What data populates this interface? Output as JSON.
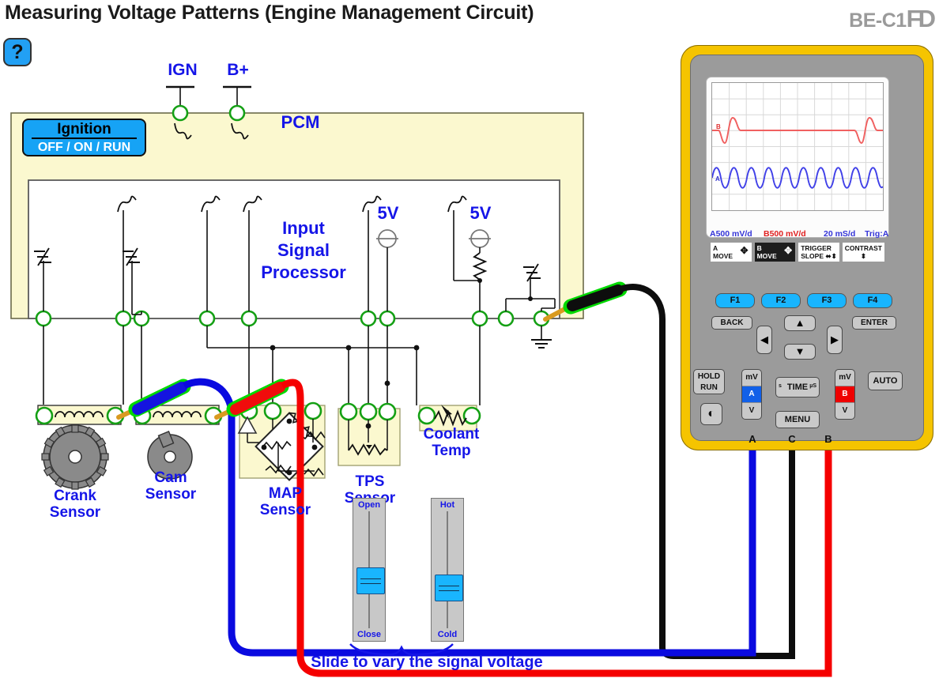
{
  "header": {
    "title": "Measuring Voltage Patterns (Engine Management Circuit)",
    "logo": "BE-C1",
    "logo_suffix": "FD",
    "help_label": "?"
  },
  "diagram": {
    "pcm_label": "PCM",
    "processor_label_line1": "Input",
    "processor_label_line2": "Signal",
    "processor_label_line3": "Processor",
    "ignition": {
      "title": "Ignition",
      "states": "OFF / ON / RUN"
    },
    "supply_labels": {
      "ign": "IGN",
      "bplus": "B+"
    },
    "rail_5v_left": "5V",
    "rail_5v_right": "5V",
    "sensors": [
      {
        "name": "crank",
        "line1": "Crank",
        "line2": "Sensor"
      },
      {
        "name": "cam",
        "line1": "Cam",
        "line2": "Sensor"
      },
      {
        "name": "map",
        "line1": "MAP",
        "line2": "Sensor"
      },
      {
        "name": "tps",
        "line1": "TPS",
        "line2": "Sensor"
      },
      {
        "name": "coolant",
        "line1": "Coolant",
        "line2": "Temp"
      }
    ],
    "sliders": [
      {
        "name": "tps-slider",
        "top_label": "Open",
        "bottom_label": "Close",
        "value_pct": 62
      },
      {
        "name": "coolant-slider",
        "top_label": "Hot",
        "bottom_label": "Cold",
        "value_pct": 70
      }
    ],
    "caption": "Slide to vary the signal voltage",
    "lead_colors": {
      "channel_a": "#0a0ae0",
      "channel_c": "#000000",
      "channel_b": "#f50000",
      "ground_probe": "#00d900"
    }
  },
  "scope": {
    "screen": {
      "readout_a": "A500 mV/d",
      "readout_b": "B500 mV/d",
      "readout_time": "20 mS/d",
      "readout_trigger": "Trig:A",
      "trace_a_label": "A",
      "trace_b_label": "B",
      "trace_a_color": "#4040e8",
      "trace_b_color": "#f06060",
      "grid_cols": 10,
      "grid_rows": 8
    },
    "softkeys": [
      {
        "line1": "A",
        "line2": "MOVE",
        "arrows": "4way",
        "inverted": false
      },
      {
        "line1": "B",
        "line2": "MOVE",
        "arrows": "4way",
        "inverted": true
      },
      {
        "line1": "TRIGGER",
        "line2": "SLOPE",
        "arrows": "split",
        "inverted": false
      },
      {
        "line1": "CONTRAST",
        "line2": "",
        "arrows": "vert",
        "inverted": false
      }
    ],
    "fkeys": [
      "F1",
      "F2",
      "F3",
      "F4"
    ],
    "nav": {
      "back": "BACK",
      "enter": "ENTER",
      "up": "▲",
      "down": "▼",
      "left": "◀",
      "right": "▶"
    },
    "controls": {
      "hold_line1": "HOLD",
      "hold_line2": "RUN",
      "power": "◐",
      "auto": "AUTO",
      "time": "TIME",
      "time_left": "s",
      "time_right": "µS",
      "menu": "MENU"
    },
    "channel_a": {
      "top": "mV",
      "mid": "A",
      "bottom": "V",
      "color": "#1160e8"
    },
    "channel_b": {
      "top": "mV",
      "mid": "B",
      "bottom": "V",
      "color": "#ef0000"
    },
    "terminals": [
      {
        "label": "A",
        "color": "#0a0ae0"
      },
      {
        "label": "C",
        "color": "#000000"
      },
      {
        "label": "B",
        "color": "#f50000"
      }
    ]
  }
}
